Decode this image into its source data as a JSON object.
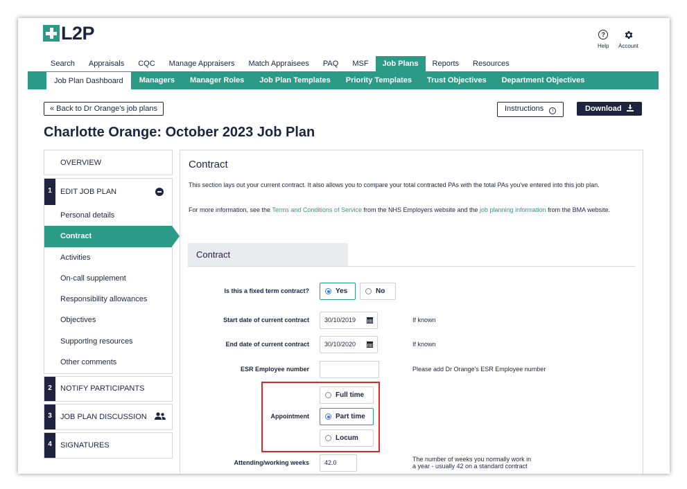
{
  "header": {
    "logo_text": "L2P",
    "help_label": "Help",
    "account_label": "Account"
  },
  "top_nav": [
    "Search",
    "Appraisals",
    "CQC",
    "Manage Appraisers",
    "Match Appraisees",
    "PAQ",
    "MSF",
    "Job Plans",
    "Reports",
    "Resources"
  ],
  "top_nav_active": "Job Plans",
  "sub_nav": [
    "Job Plan Dashboard",
    "Managers",
    "Manager Roles",
    "Job Plan Templates",
    "Priority Templates",
    "Trust Objectives",
    "Department Objectives"
  ],
  "sub_nav_active": "Job Plan Dashboard",
  "actions": {
    "back": "« Back to Dr Orange's job plans",
    "instructions": "Instructions",
    "download": "Download"
  },
  "page_title": "Charlotte Orange: October 2023 Job Plan",
  "sidebar": {
    "overview": "OVERVIEW",
    "step1": {
      "num": "1",
      "label": "EDIT JOB PLAN"
    },
    "items": [
      "Personal details",
      "Contract",
      "Activities",
      "On-call supplement",
      "Responsibility allowances",
      "Objectives",
      "Supporting resources",
      "Other comments"
    ],
    "active_item": "Contract",
    "step2": {
      "num": "2",
      "label": "NOTIFY PARTICIPANTS"
    },
    "step3": {
      "num": "3",
      "label": "JOB PLAN DISCUSSION"
    },
    "step4": {
      "num": "4",
      "label": "SIGNATURES"
    }
  },
  "content": {
    "heading": "Contract",
    "intro": "This section lays out your current contract. It also allows you to compare your total contracted PAs with the total PAs you've entered into this job plan.",
    "more_prefix": "For more information, see the ",
    "link1": "Terms and Conditions of Service",
    "more_mid": " from the NHS Employers website and the ",
    "link2": "job planning information",
    "more_suffix": " from the BMA website.",
    "section_tab": "Contract",
    "fixed_term": {
      "label": "Is this a fixed term contract?",
      "options": [
        "Yes",
        "No"
      ],
      "selected": "Yes"
    },
    "start_date": {
      "label": "Start date of current contract",
      "value": "30/10/2019",
      "hint": "If known"
    },
    "end_date": {
      "label": "End date of current contract",
      "value": "30/10/2020",
      "hint": "If known"
    },
    "esr": {
      "label": "ESR Employee number",
      "value": "",
      "hint": "Please add Dr Orange's ESR Employee number"
    },
    "appointment": {
      "label": "Appointment",
      "options": [
        "Full time",
        "Part time",
        "Locum"
      ],
      "selected": "Part time"
    },
    "weeks": {
      "label": "Attending/working weeks",
      "value": "42.0",
      "hint_line1": "The number of weeks you normally work in",
      "hint_line2": "a year - usually 42 on a standard contract"
    }
  },
  "colors": {
    "teal": "#2b9a87",
    "navy": "#1f2340",
    "highlight": "#e0262a"
  }
}
